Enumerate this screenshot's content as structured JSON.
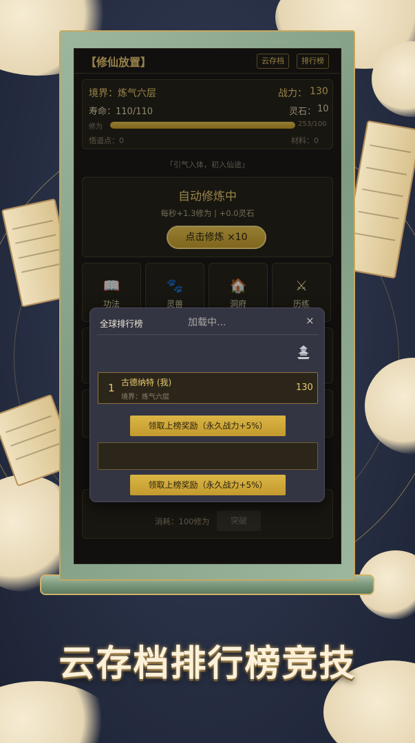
{
  "header": {
    "app_title": "【修仙放置】",
    "cloud_save_label": "云存档",
    "leaderboard_label": "排行榜"
  },
  "status": {
    "realm_label": "境界：炼气六层",
    "power_label": "战力：",
    "power_value": "130",
    "life_label": "寿命：110/110",
    "spirit_stone_label": "灵石：",
    "spirit_stone_value": "10",
    "cultivation_label": "修为",
    "cultivation_text": "253/100",
    "cultivation_progress": 1.0,
    "insight_label": "悟道点：0",
    "materials_label": "材料：0"
  },
  "quote": "「引气入体，初入仙途」",
  "auto_cultivate": {
    "title": "自动修炼中",
    "rate": "每秒+1.3修为 | +0.0灵石",
    "click_button": "点击修炼 ×10"
  },
  "tiles": [
    {
      "label": "功法",
      "icon": "book-icon"
    },
    {
      "label": "灵兽",
      "icon": "paw-icon"
    },
    {
      "label": "洞府",
      "icon": "house-icon"
    },
    {
      "label": "历练",
      "icon": "swords-icon"
    }
  ],
  "breakthrough": {
    "cost": "消耗：100修为",
    "button": "突破"
  },
  "modal": {
    "title": "全球排行榜",
    "loading": "加载中...",
    "close": "×",
    "entries": [
      {
        "rank": "1",
        "name": "古德纳特 (我)",
        "realm": "境界：炼气六层",
        "power": "130"
      }
    ],
    "reward_button_1": "领取上榜奖励（永久战力+5%）",
    "reward_button_2": "领取上榜奖励（永久战力+5%）"
  },
  "banner": "云存档排行榜竞技",
  "colors": {
    "accent_gold": "#e8c870",
    "panel_bg": "#262219",
    "modal_bg": "#343543",
    "frame_jade": "#8fab92"
  }
}
